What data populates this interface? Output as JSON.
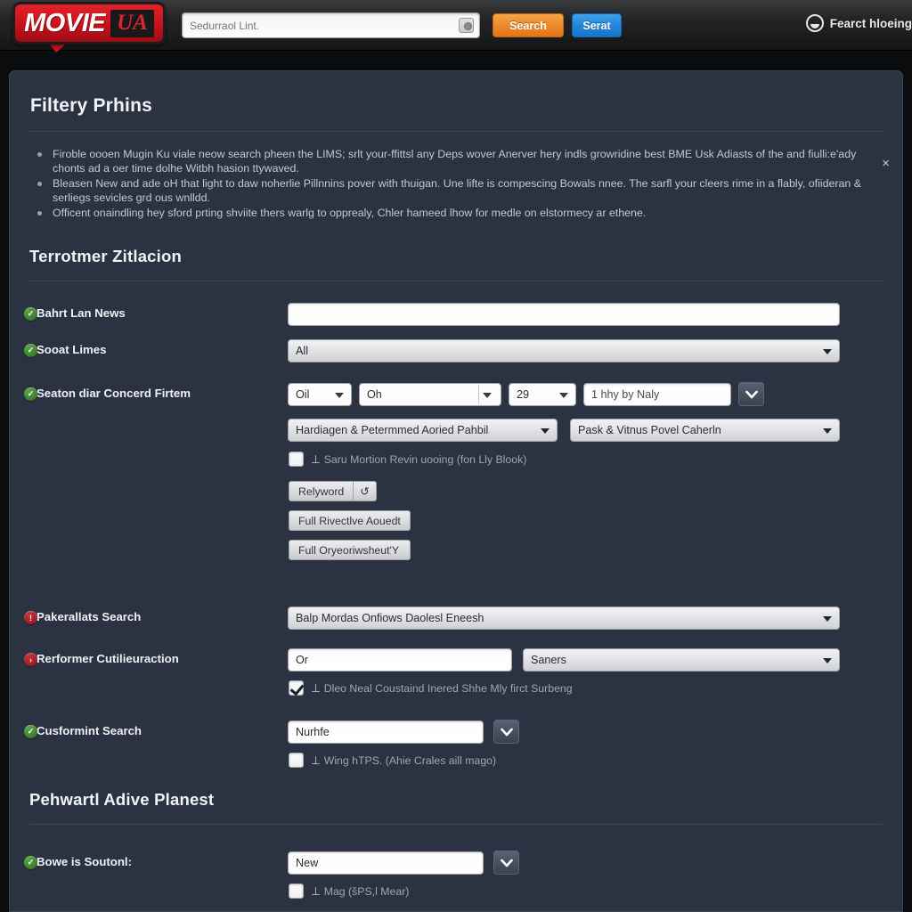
{
  "header": {
    "logo_main": "MOVIE",
    "logo_badge": "UA",
    "search_placeholder": "Sedurraol Lint.",
    "search_value": "",
    "camera_icon": "camera-icon",
    "search_button": "Search",
    "secondary_button": "Serat",
    "account_icon": "face-circle-icon",
    "account_label": "Fearct hloeing"
  },
  "panel": {
    "title": "Filtery Prhins",
    "close_label": "×",
    "bullets": [
      "Firoble oooen Mugin Ku viale neow search pheen the LIMS; srlt your-ffittsl any Deps wover Anerver hery indls growridine best BME Usk Adiasts of the and fiulli:e'ady chonts ad a oer time dolhe Witbh hasion ttywaved.",
      "Bleasen New and ade oH that light to daw noherlie Pillnnins pover with thuigan. Une lifte is compescing Bowals nnee. The sarfl your cleers rime in a flably, ofiideran & serliegs sevicles grd ous wnlldd.",
      "Officent onaindling hey sford prting shviite thers warlg to opprealy, Chler hameed lhow for medle on elstormecy ar ethene."
    ]
  },
  "section1": {
    "title": "Terrotmer Zitlacion",
    "rows": [
      {
        "label": "Bahrt Lan News",
        "badge": "green",
        "badge_icon": "check-badge-icon",
        "value": ""
      },
      {
        "label": "Sooat Limes",
        "badge": "green",
        "badge_icon": "check-badge-icon",
        "value": "All"
      },
      {
        "label": "Seaton diar Concerd Firtem",
        "badge": "green",
        "badge_icon": "check-badge-icon",
        "select_a": "Oil",
        "select_b": "Oh",
        "select_c": "29",
        "input_d": "1 hhy by Naly",
        "chevron_icon": "chevron-down-icon",
        "select_e": "Hardiagen & Petermmed Aoried Pahbil",
        "select_f": "Pask & Vitnus Povel Caherln",
        "checkbox_label": "Saru Mortion Revin uooing (fon Lly Blook)",
        "checkbox_checked": false,
        "btn_keyword": "Relyword",
        "btn_refresh_icon": "refresh-icon",
        "btn_refresh": "↺",
        "btn_full_1": "Full Rivectlve Aouedt",
        "btn_full_2": "Full Oryeoriwsheut'Y"
      },
      {
        "label": "Pakerallats Search",
        "badge": "red",
        "badge_icon": "alert-badge-icon",
        "value": "Balp Mordas Onfiows Daolesl Eneesh"
      },
      {
        "label": "Rerformer Cutilieuraction",
        "badge": "red",
        "badge_icon": "arrow-badge-icon",
        "input_value": "Or",
        "select_value": "Saners",
        "checkbox_label": "Dleo Neal Coustaind Inered Shhe Mly firct Surbeng",
        "checkbox_checked": true
      },
      {
        "label": "Cusformint Search",
        "badge": "green",
        "badge_icon": "check-badge-icon",
        "input_value": "Nurhfe",
        "chevron_icon": "chevron-down-icon",
        "checkbox_label": "Wing hTPS. (Ahie Crales aill magо)",
        "checkbox_checked": false
      }
    ]
  },
  "section2": {
    "title": "Pehwartl  Adive Planest",
    "rows": [
      {
        "label": "Bowe is Soutonl:",
        "badge": "green",
        "badge_icon": "check-badge-icon",
        "input_value": "New",
        "chevron_icon": "chevron-down-icon",
        "checkbox_label": "Mag (šPS,l Mear)",
        "checkbox_checked": false
      }
    ]
  },
  "colors": {
    "accent_orange": "#ef8a2b",
    "accent_blue": "#2288dd",
    "brand_red": "#c6121c",
    "panel_bg": "#2b3342",
    "page_bg": "#0b0c0e",
    "badge_green": "#3f8a2c",
    "badge_red": "#b2272d"
  }
}
